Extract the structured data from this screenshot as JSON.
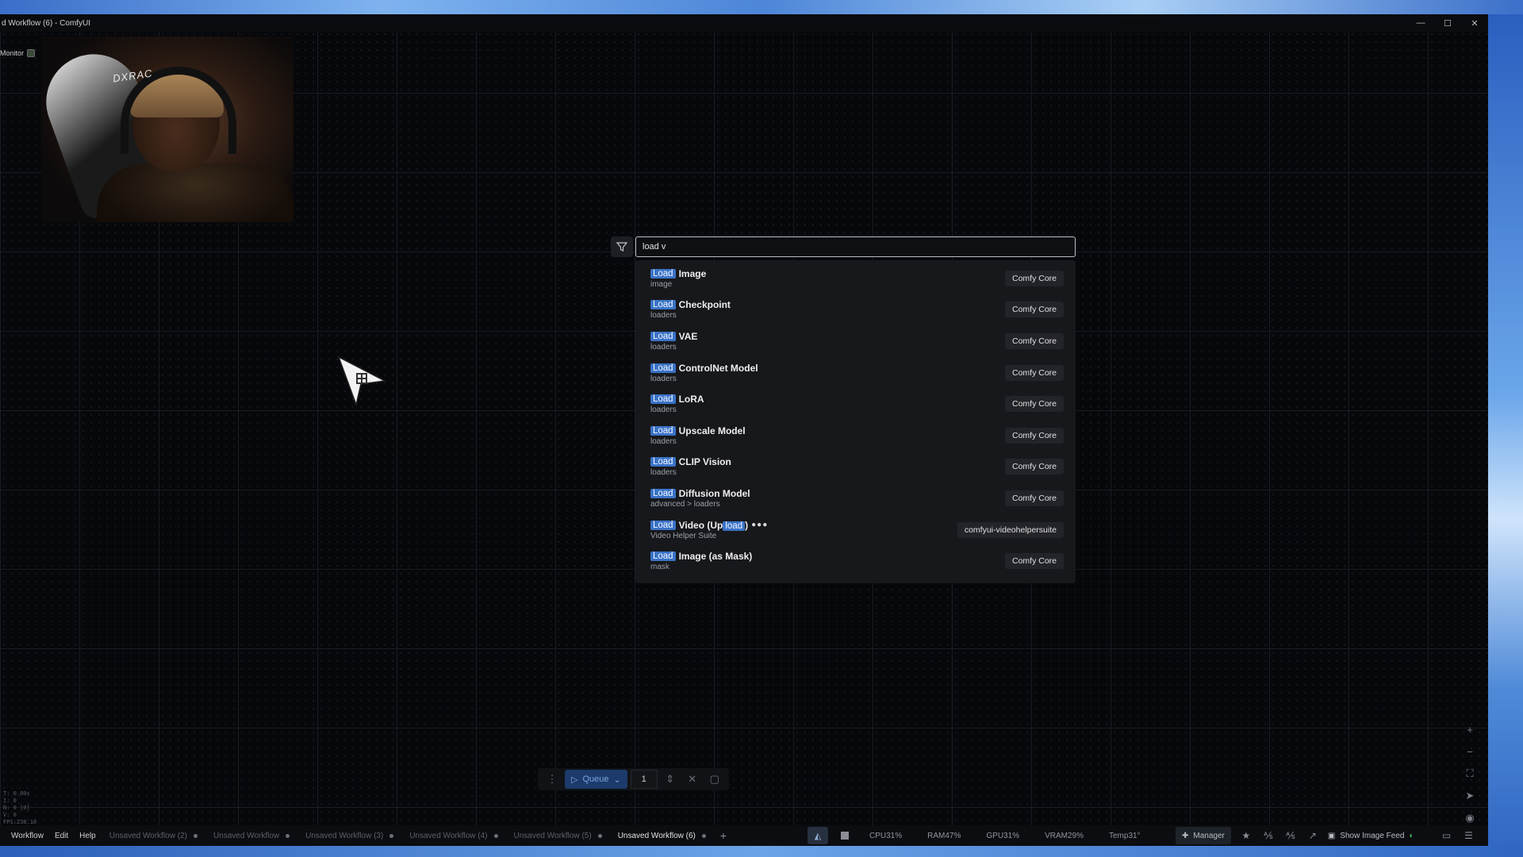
{
  "window": {
    "title": "d Workflow (6) - ComfyUI",
    "controls": [
      "—",
      "☐",
      "✕"
    ]
  },
  "monitor_label": "Monitor",
  "webcam": {
    "brand_text": "DXRAC"
  },
  "search": {
    "value": "load v",
    "results": [
      {
        "highlight": "Load",
        "name": "Image",
        "category": "image",
        "source": "Comfy Core"
      },
      {
        "highlight": "Load",
        "name": "Checkpoint",
        "category": "loaders",
        "source": "Comfy Core"
      },
      {
        "highlight": "Load",
        "name": "VAE",
        "category": "loaders",
        "source": "Comfy Core"
      },
      {
        "highlight": "Load",
        "name": "ControlNet Model",
        "category": "loaders",
        "source": "Comfy Core"
      },
      {
        "highlight": "Load",
        "name": "LoRA",
        "category": "loaders",
        "source": "Comfy Core"
      },
      {
        "highlight": "Load",
        "name": "Upscale Model",
        "category": "loaders",
        "source": "Comfy Core"
      },
      {
        "highlight": "Load",
        "name": "CLIP Vision",
        "category": "loaders",
        "source": "Comfy Core"
      },
      {
        "highlight": "Load",
        "name": "Diffusion Model",
        "category": "advanced > loaders",
        "source": "Comfy Core"
      },
      {
        "highlight": "Load",
        "name_pre": "Video (Up",
        "name_hl": "load",
        "name_post": ")",
        "category": "Video Helper Suite",
        "source": "comfyui-videohelpersuite",
        "dots": "●●●"
      },
      {
        "highlight": "Load",
        "name": "Image (as Mask)",
        "category": "mask",
        "source": "Comfy Core"
      }
    ]
  },
  "queue": {
    "label": "Queue",
    "count": "1"
  },
  "bottom": {
    "menu": [
      "Workflow",
      "Edit",
      "Help"
    ],
    "tabs": [
      {
        "label": "Unsaved Workflow (2)",
        "active": false
      },
      {
        "label": "Unsaved Workflow",
        "active": false
      },
      {
        "label": "Unsaved Workflow (3)",
        "active": false
      },
      {
        "label": "Unsaved Workflow (4)",
        "active": false
      },
      {
        "label": "Unsaved Workflow (5)",
        "active": false
      },
      {
        "label": "Unsaved Workflow (6)",
        "active": true
      }
    ],
    "stats": {
      "cpu": "CPU31%",
      "ram": "RAM47%",
      "gpu": "GPU31%",
      "vram": "VRAM29%",
      "temp": "Temp31°"
    },
    "manager_label": "Manager",
    "feed_label": "Show Image Feed"
  },
  "debug": [
    "T: 0.00s",
    "I: 0",
    "N: 0 [0]",
    "V: 0",
    "FPS:238.10"
  ],
  "colors": {
    "highlight": "#3a73c7",
    "canvas_bg": "#07080b",
    "accent_queue": "#1c3a6b"
  }
}
